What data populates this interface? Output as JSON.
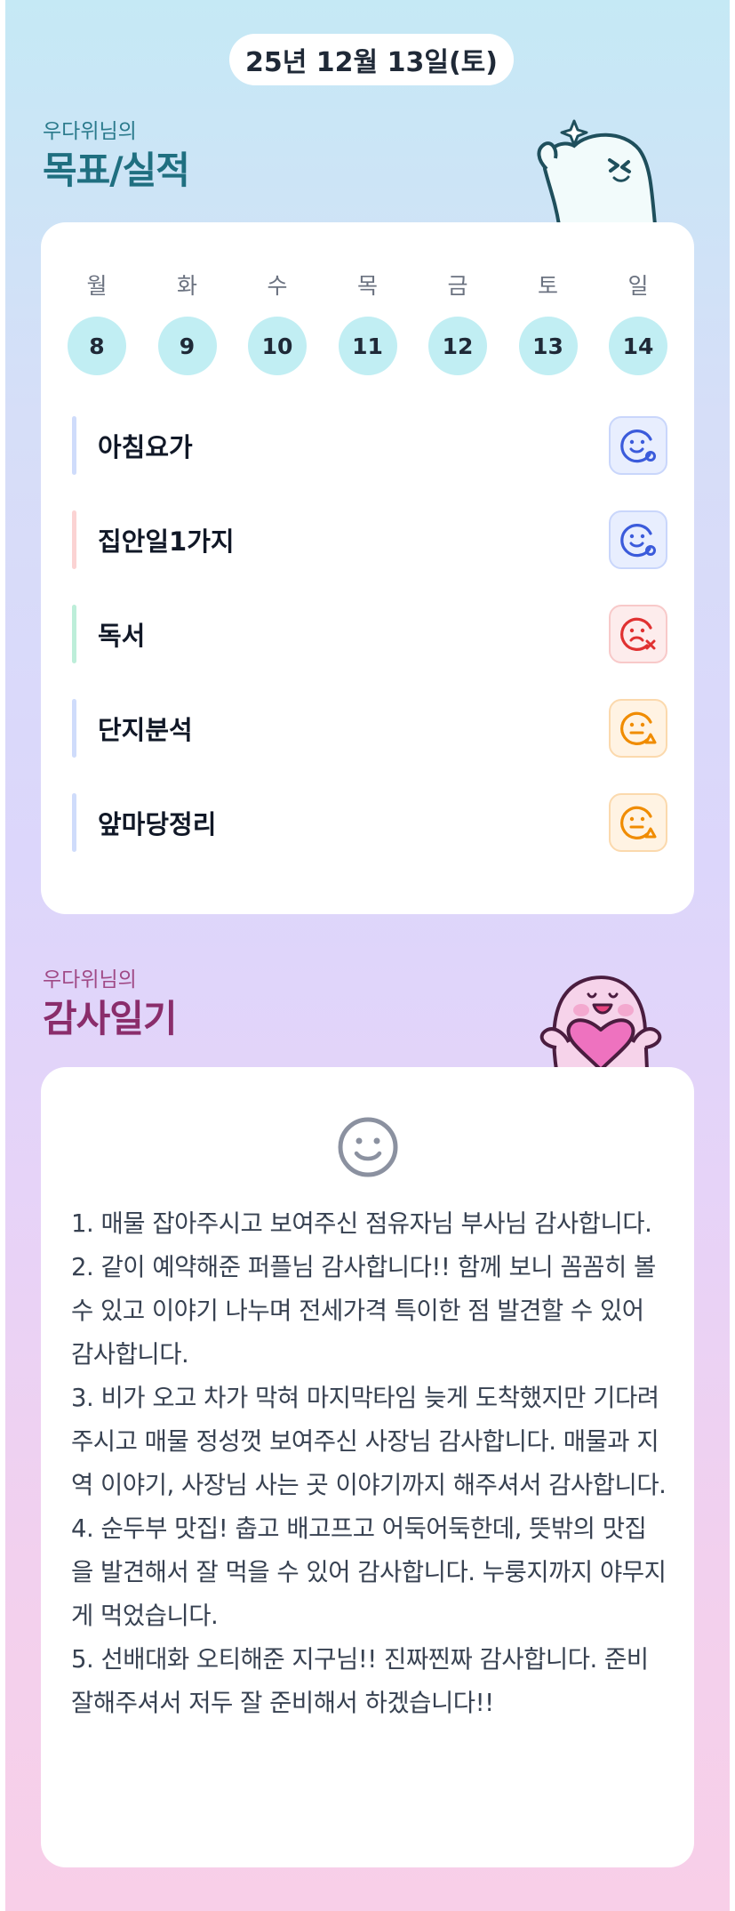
{
  "date": "25년 12월 13일(토)",
  "goals_section": {
    "subtitle": "우다위님의",
    "title": "목표/실적",
    "weekdays": [
      "월",
      "화",
      "수",
      "목",
      "금",
      "토",
      "일"
    ],
    "days": [
      "8",
      "9",
      "10",
      "11",
      "12",
      "13",
      "14"
    ],
    "items": [
      {
        "label": "아침요가",
        "bar_color": "#cfdcfb",
        "status": "done-smile-icon"
      },
      {
        "label": "집안일1가지",
        "bar_color": "#fbd3d3",
        "status": "done-smile-icon"
      },
      {
        "label": "독서",
        "bar_color": "#bdeed9",
        "status": "failed-sad-icon"
      },
      {
        "label": "단지분석",
        "bar_color": "#cfdcfb",
        "status": "partial-neutral-icon"
      },
      {
        "label": "앞마당정리",
        "bar_color": "#cfdcfb",
        "status": "partial-neutral-icon"
      }
    ]
  },
  "gratitude_section": {
    "subtitle": "우다위님의",
    "title": "감사일기",
    "mood_icon": "smile-face-icon",
    "entries": [
      "1. 매물 잡아주시고 보여주신 점유자님 부사님 감사합니다.",
      "2. 같이 예약해준 퍼플님 감사합니다!! 함께 보니 꼼꼼히 볼 수 있고  이야기 나누며 전세가격 특이한 점 발견할 수 있어 감사합니다.",
      "3. 비가 오고 차가 막혀 마지막타임 늦게 도착했지만 기다려주시고 매물 정성껏 보여주신 사장님 감사합니다. 매물과 지역 이야기, 사장님 사는 곳 이야기까지 해주셔서 감사합니다.",
      "4. 순두부 맛집! 춥고 배고프고 어둑어둑한데, 뜻밖의 맛집을 발견해서 잘 먹을 수 있어 감사합니다. 누룽지까지 야무지게 먹었습니다.",
      "5. 선배대화 오티해준 지구님!! 진짜찐짜 감사합니다. 준비잘해주셔서 저두 잘 준비해서 하겠습니다!!"
    ]
  },
  "colors": {
    "goals_title": "#1f6f80",
    "gratitude_title": "#8a2d6b",
    "good": "#3b5bdb",
    "bad": "#e03131",
    "mid": "#f08c00"
  }
}
